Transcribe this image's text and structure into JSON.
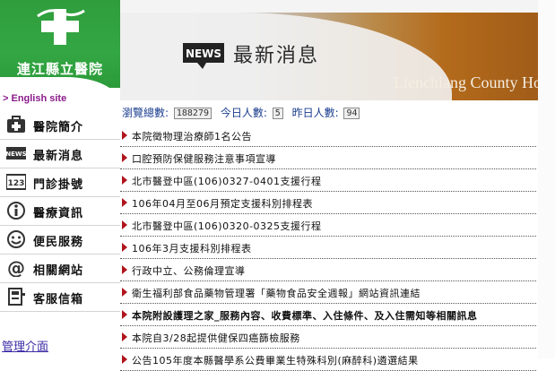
{
  "sidebar": {
    "hospital_name": "連江縣立醫院",
    "english_link": "> English site",
    "items": [
      {
        "label": "醫院簡介",
        "icon": "first-aid-kit-icon"
      },
      {
        "label": "最新消息",
        "icon": "news-icon"
      },
      {
        "label": "門診掛號",
        "icon": "number-123-icon"
      },
      {
        "label": "醫療資訊",
        "icon": "info-icon"
      },
      {
        "label": "便民服務",
        "icon": "smiley-icon"
      },
      {
        "label": "相關網站",
        "icon": "at-sign-icon"
      },
      {
        "label": "客服信箱",
        "icon": "mailbox-icon"
      }
    ],
    "admin_link": "管理介面"
  },
  "banner": {
    "badge": "NEWS",
    "title": "最新消息",
    "english_name": "Lienchiang County Ho"
  },
  "counter": {
    "total_label": "瀏覽總數:",
    "total_value": "188279",
    "today_label": "今日人數:",
    "today_value": "5",
    "yesterday_label": "昨日人數:",
    "yesterday_value": "94"
  },
  "news": [
    {
      "title": "本院徵物理治療師1名公告",
      "bold": false
    },
    {
      "title": "口腔預防保健服務注意事項宣導",
      "bold": false
    },
    {
      "title": "北市醫登中區(106)0327-0401支援行程",
      "bold": false
    },
    {
      "title": "106年04月至06月預定支援科別排程表",
      "bold": false
    },
    {
      "title": "北市醫登中區(106)0320-0325支援行程",
      "bold": false
    },
    {
      "title": "106年3月支援科別排程表",
      "bold": false
    },
    {
      "title": "行政中立、公務倫理宣導",
      "bold": false
    },
    {
      "title": "衛生福利部食品藥物管理署「藥物食品安全週報」網站資訊連結",
      "bold": false
    },
    {
      "title": "本院附設護理之家_服務內容、收費標準、入住條件、及入住需知等相關訊息",
      "bold": true
    },
    {
      "title": "本院自3/28起提供健保四癌篩檢服務",
      "bold": false
    },
    {
      "title": "公告105年度本縣醫學系公費畢業生特殊科別(麻醉科)遴選結果",
      "bold": false
    }
  ],
  "colors": {
    "sidebar_green": "#33a743",
    "bullet_red": "#b0141c",
    "counter_blue": "#1a3d8f",
    "english_link_purple": "#8a1a8a"
  }
}
